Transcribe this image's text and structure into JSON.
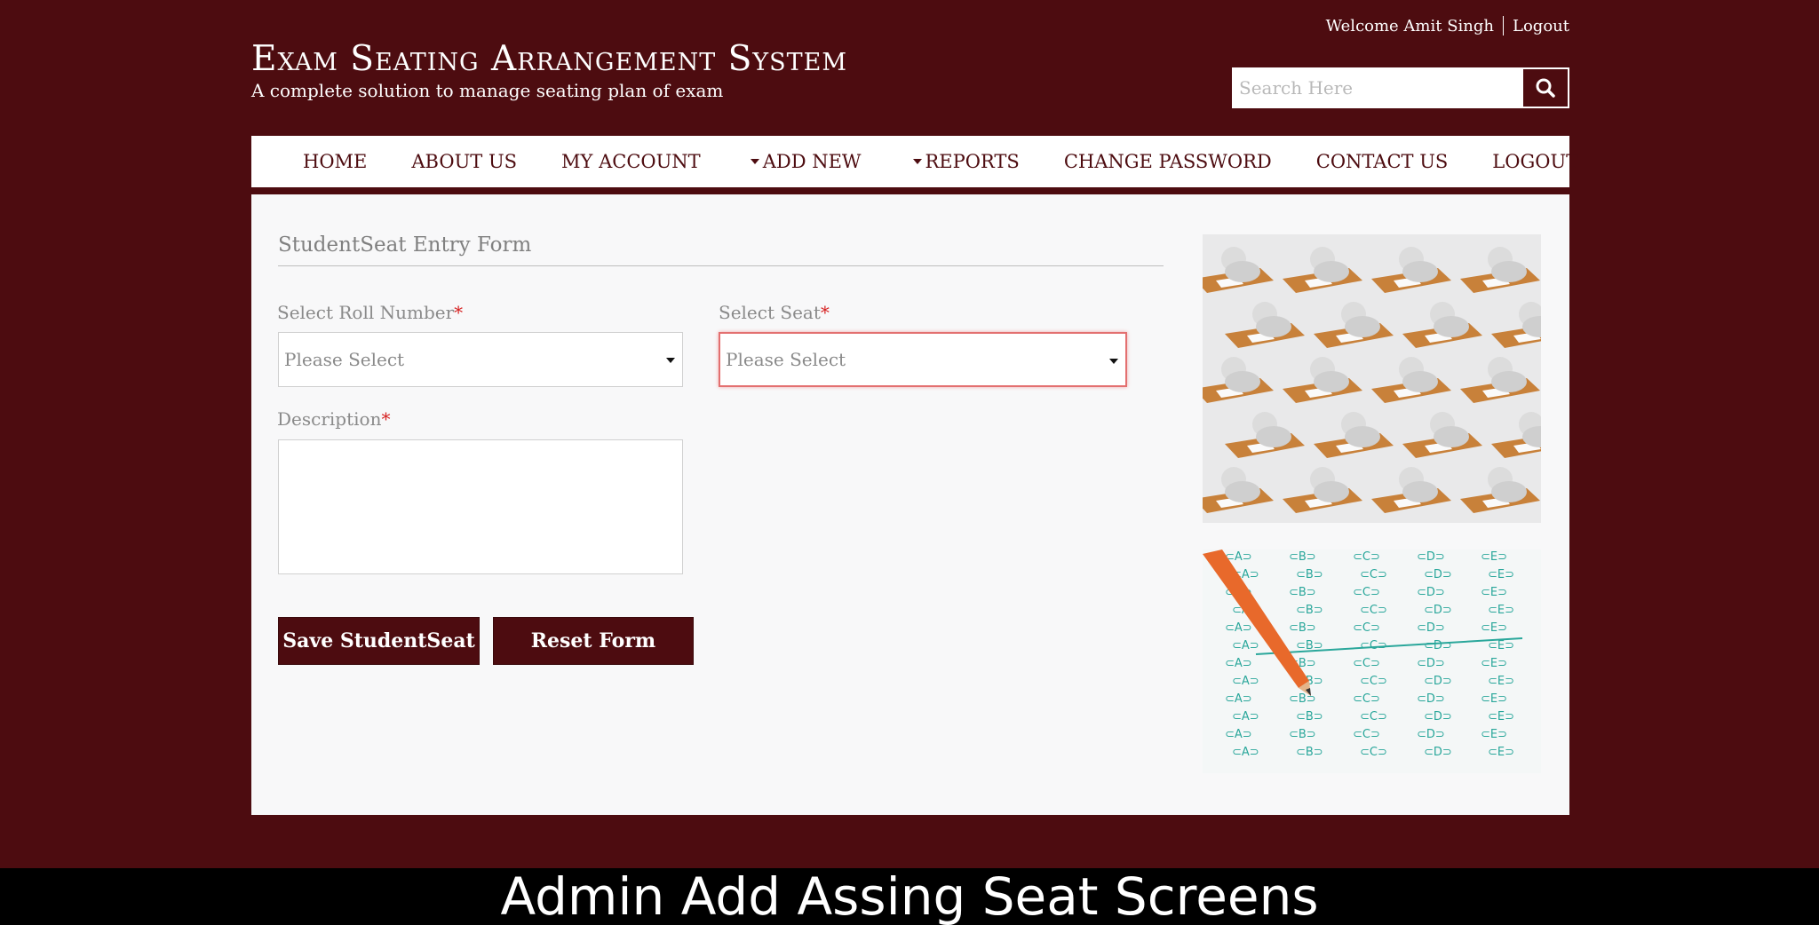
{
  "header": {
    "welcome": "Welcome Amit Singh",
    "logout_link": "Logout",
    "title": "Exam Seating Arrangement System",
    "subtitle": "A complete solution to manage seating plan of exam",
    "search_placeholder": "Search Here",
    "search_icon": "search-icon"
  },
  "nav": {
    "items": [
      {
        "label": "HOME"
      },
      {
        "label": "ABOUT US"
      },
      {
        "label": "MY ACCOUNT"
      },
      {
        "label": "ADD NEW"
      },
      {
        "label": "REPORTS"
      },
      {
        "label": "CHANGE PASSWORD"
      },
      {
        "label": "CONTACT US"
      },
      {
        "label": "LOGOUT"
      }
    ]
  },
  "form": {
    "title": "StudentSeat Entry Form",
    "roll_label": "Select Roll Number",
    "roll_value": "Please Select",
    "seat_label": "Select Seat",
    "seat_value": "Please Select",
    "description_label": "Description",
    "required_mark": "*",
    "save_button": "Save StudentSeat",
    "reset_button": "Reset Form"
  },
  "caption": "Admin Add Assing Seat Screens",
  "colors": {
    "brand": "#4d0c10",
    "panel": "#f8f8f9",
    "required": "#d62020",
    "error_border": "#e37070",
    "answer_sheet_teal": "#2aa79b",
    "desk_wood": "#c8813a"
  }
}
